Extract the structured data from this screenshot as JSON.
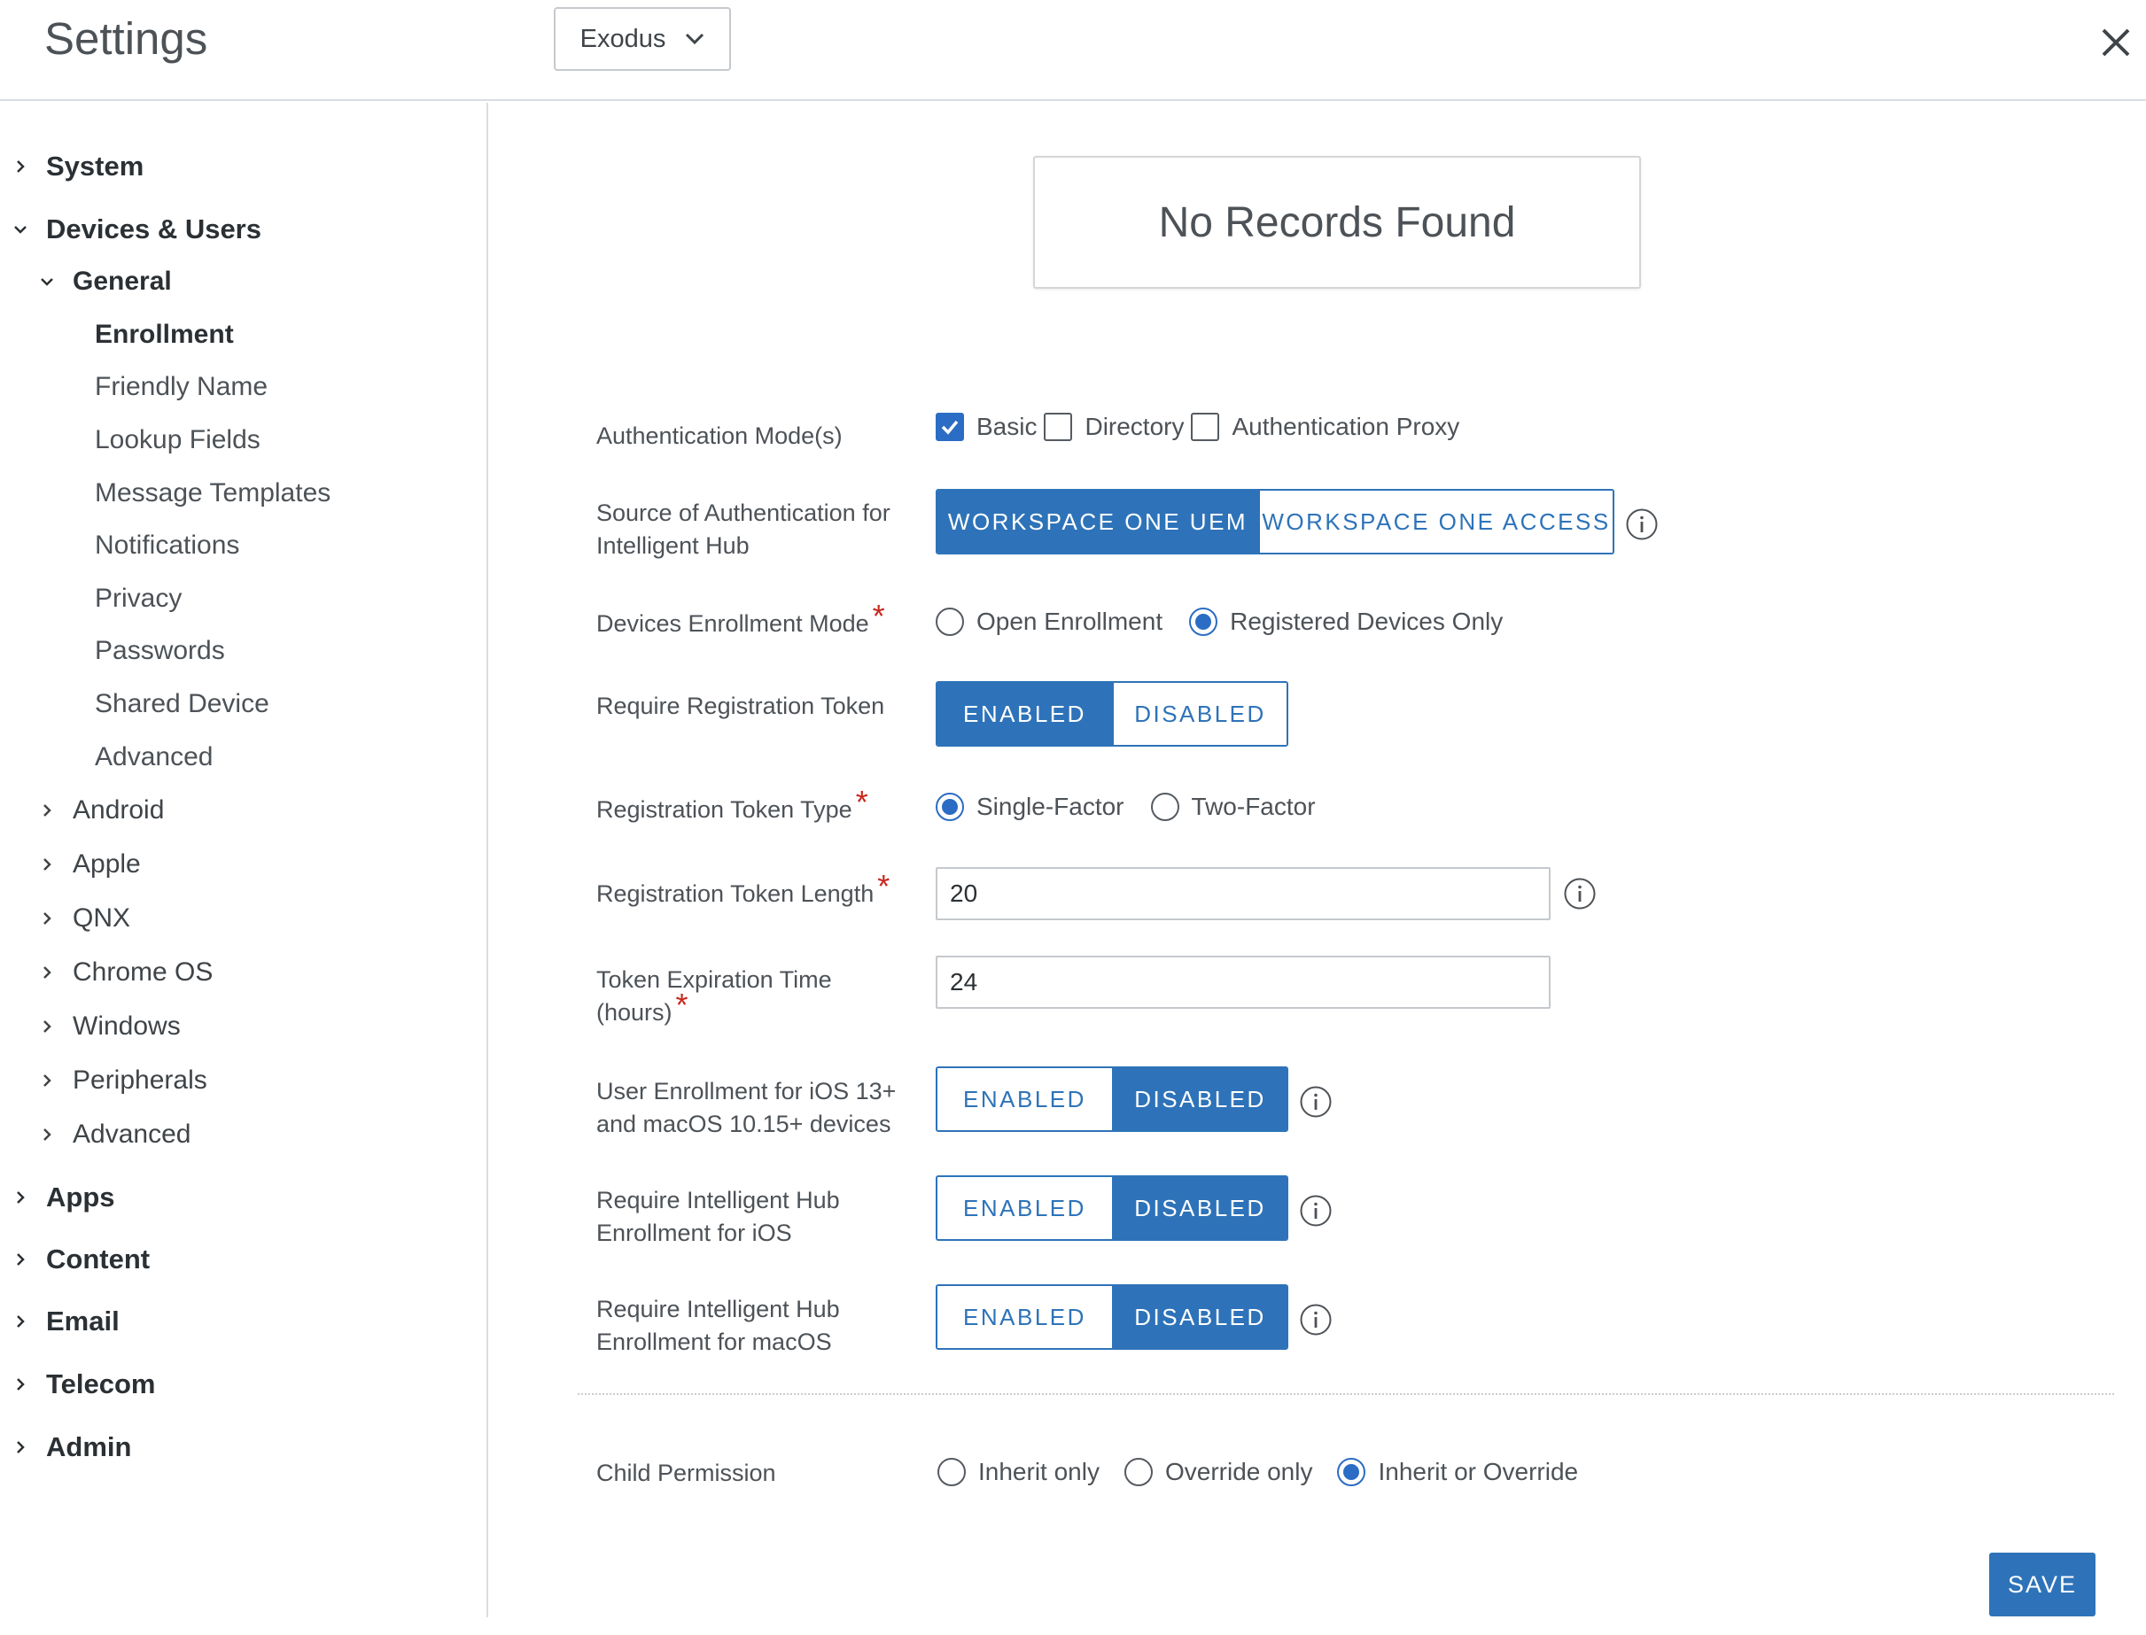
{
  "header": {
    "title": "Settings",
    "org_group": "Exodus"
  },
  "sidebar": {
    "items": [
      {
        "label": "System"
      },
      {
        "label": "Devices & Users"
      },
      {
        "label": "General"
      },
      {
        "label": "Enrollment"
      },
      {
        "label": "Friendly Name"
      },
      {
        "label": "Lookup Fields"
      },
      {
        "label": "Message Templates"
      },
      {
        "label": "Notifications"
      },
      {
        "label": "Privacy"
      },
      {
        "label": "Passwords"
      },
      {
        "label": "Shared Device"
      },
      {
        "label": "Advanced"
      },
      {
        "label": "Android"
      },
      {
        "label": "Apple"
      },
      {
        "label": "QNX"
      },
      {
        "label": "Chrome OS"
      },
      {
        "label": "Windows"
      },
      {
        "label": "Peripherals"
      },
      {
        "label": "Advanced"
      },
      {
        "label": "Apps"
      },
      {
        "label": "Content"
      },
      {
        "label": "Email"
      },
      {
        "label": "Telecom"
      },
      {
        "label": "Admin"
      }
    ]
  },
  "main": {
    "empty_state": "No Records Found",
    "auth_modes": {
      "label": "Authentication Mode(s)",
      "options": [
        {
          "label": "Basic",
          "checked": true
        },
        {
          "label": "Directory",
          "checked": false
        },
        {
          "label": "Authentication Proxy",
          "checked": false
        }
      ]
    },
    "auth_source": {
      "label": "Source of Authentication for Intelligent Hub",
      "options": [
        "WORKSPACE ONE UEM",
        "WORKSPACE ONE ACCESS"
      ],
      "selected": "WORKSPACE ONE UEM"
    },
    "enrollment_mode": {
      "label": "Devices Enrollment Mode",
      "required_mark": "*",
      "options": [
        "Open Enrollment",
        "Registered Devices Only"
      ],
      "selected": "Registered Devices Only"
    },
    "require_token": {
      "label": "Require Registration Token",
      "enabled": "ENABLED",
      "disabled": "DISABLED",
      "selected": "ENABLED"
    },
    "token_type": {
      "label": "Registration Token Type",
      "required_mark": "*",
      "options": [
        "Single-Factor",
        "Two-Factor"
      ],
      "selected": "Single-Factor"
    },
    "token_length": {
      "label": "Registration Token Length",
      "required_mark": "*",
      "value": "20"
    },
    "token_expiration": {
      "label_line1": "Token Expiration Time",
      "label_line2": "(hours)",
      "required_mark": "*",
      "value": "24"
    },
    "user_enrollment": {
      "label": "User Enrollment for iOS 13+ and macOS 10.15+ devices",
      "enabled": "ENABLED",
      "disabled": "DISABLED",
      "selected": "DISABLED"
    },
    "hub_ios": {
      "label": "Require Intelligent Hub Enrollment for iOS",
      "enabled": "ENABLED",
      "disabled": "DISABLED",
      "selected": "DISABLED"
    },
    "hub_macos": {
      "label": "Require Intelligent Hub Enrollment for macOS",
      "enabled": "ENABLED",
      "disabled": "DISABLED",
      "selected": "DISABLED"
    },
    "child_permission": {
      "label": "Child Permission",
      "options": [
        "Inherit only",
        "Override only",
        "Inherit or Override"
      ],
      "selected": "Inherit or Override"
    },
    "save_label": "SAVE"
  },
  "colors": {
    "accent": "#2e73b9",
    "checkbox": "#2b6cc4",
    "required": "#c8281e"
  },
  "icons": {
    "close": "close-icon",
    "dropdown": "chevron-down-icon",
    "expand": "chevron-right-icon",
    "collapse": "chevron-down-icon",
    "info": "info-icon"
  }
}
